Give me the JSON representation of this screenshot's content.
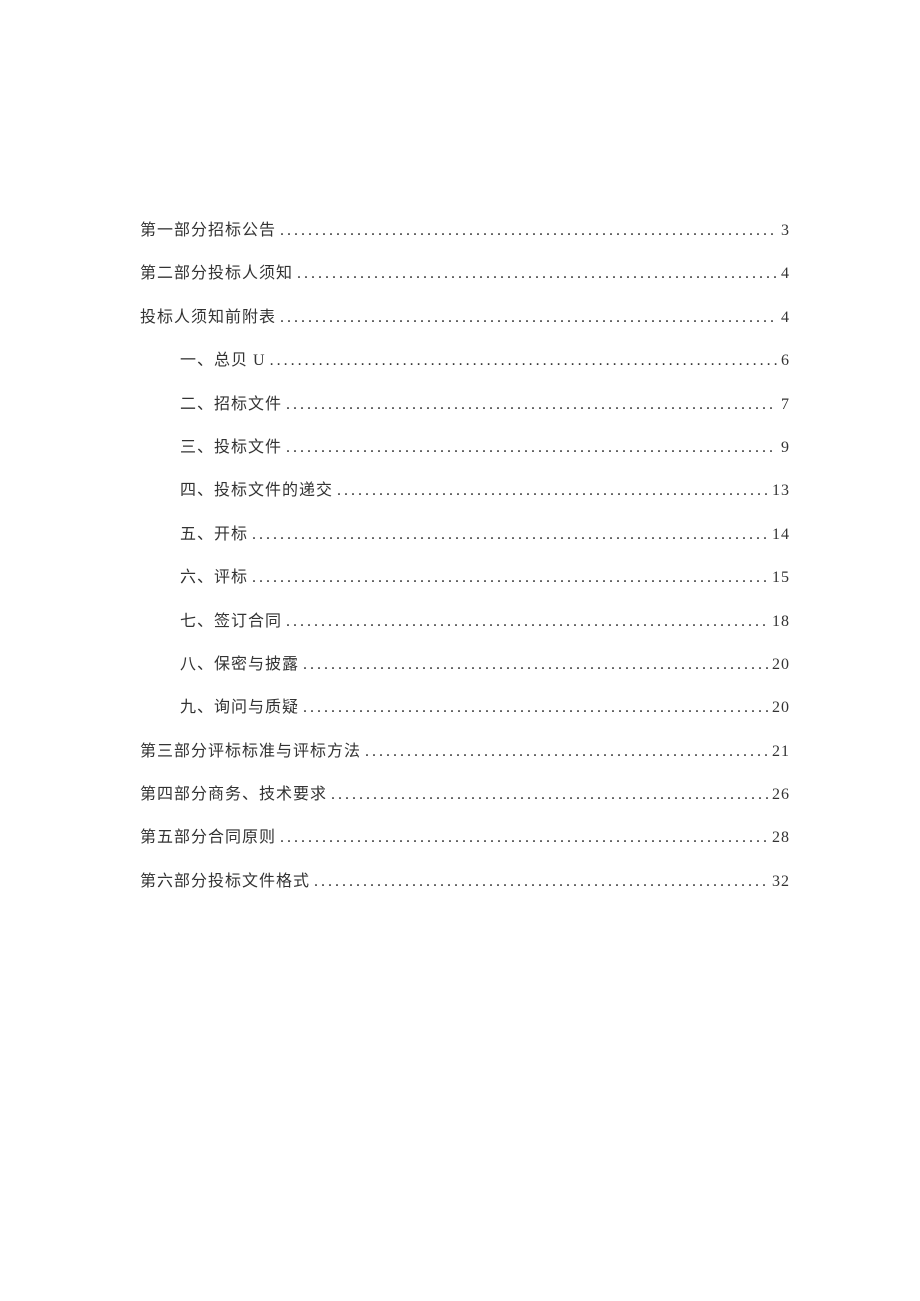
{
  "toc": {
    "entries": [
      {
        "level": 1,
        "label": "第一部分招标公告",
        "page": "3"
      },
      {
        "level": 1,
        "label": "第二部分投标人须知",
        "page": "4"
      },
      {
        "level": 1,
        "label": "投标人须知前附表",
        "page": "4"
      },
      {
        "level": 2,
        "label": "一、总贝 U",
        "page": "6"
      },
      {
        "level": 2,
        "label": "二、招标文件",
        "page": "7"
      },
      {
        "level": 2,
        "label": "三、投标文件",
        "page": "9"
      },
      {
        "level": 2,
        "label": "四、投标文件的递交",
        "page": "13"
      },
      {
        "level": 2,
        "label": "五、开标",
        "page": "14"
      },
      {
        "level": 2,
        "label": "六、评标",
        "page": "15"
      },
      {
        "level": 2,
        "label": "七、签订合同",
        "page": "18"
      },
      {
        "level": 2,
        "label": "八、保密与披露",
        "page": "20"
      },
      {
        "level": 2,
        "label": "九、询问与质疑",
        "page": "20"
      },
      {
        "level": 1,
        "label": "第三部分评标标准与评标方法",
        "page": "21"
      },
      {
        "level": 1,
        "label": "第四部分商务、技术要求",
        "page": "26"
      },
      {
        "level": 1,
        "label": "第五部分合同原则",
        "page": "28"
      },
      {
        "level": 1,
        "label": "第六部分投标文件格式",
        "page": "32"
      }
    ]
  }
}
